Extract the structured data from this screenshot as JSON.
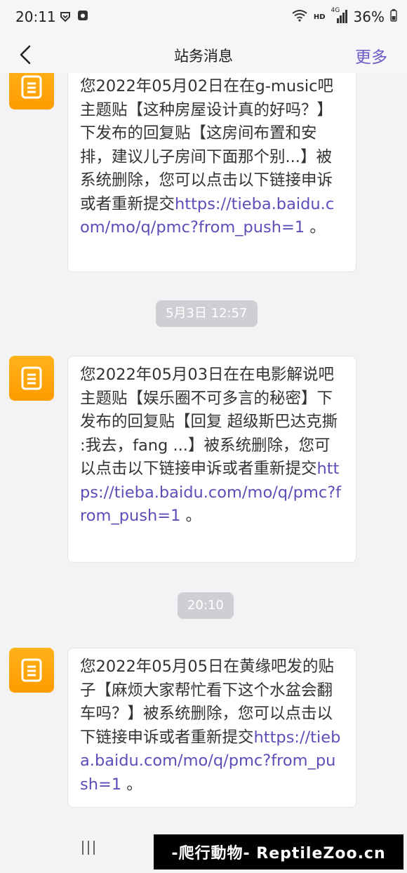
{
  "status_bar": {
    "time": "20:11",
    "battery": "36%",
    "network_label": "HD",
    "network_gen": "4G"
  },
  "header": {
    "title": "站务消息",
    "more_label": "更多"
  },
  "messages": [
    {
      "text": "您2022年05月02日在在g-music吧主题贴【这种房屋设计真的好吗？】下发布的回复贴【这房间布置和安排，建议儿子房间下面那个别...】被系统删除，您可以点击以下链接申诉或者重新提交",
      "link": "https://tieba.baidu.com/mo/q/pmc?from_push=1",
      "end": " 。"
    },
    {
      "text": "您2022年05月03日在在电影解说吧主题贴【娱乐圈不可多言的秘密】下发布的回复贴【回复 超级斯巴达克撕 :我去，fang ...】被系统删除，您可以点击以下链接申诉或者重新提交",
      "link": "https://tieba.baidu.com/mo/q/pmc?from_push=1",
      "end": " 。"
    },
    {
      "text": "您2022年05月05日在黄缘吧发的贴子【麻烦大家帮忙看下这个水盆会翻车吗？】被系统删除，您可以点击以下链接申诉或者重新提交",
      "link": "https://tieba.baidu.com/mo/q/pmc?from_push=1",
      "end": " 。"
    }
  ],
  "timestamps": [
    "5月3日 12:57",
    "20:10"
  ],
  "watermark": "-爬行動物- ReptileZoo.cn",
  "colors": {
    "accent": "#6b59c8",
    "link": "#5a4fb8",
    "avatar": "#ff9f00"
  }
}
